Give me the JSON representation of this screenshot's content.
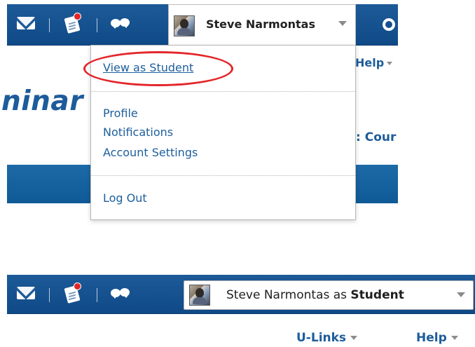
{
  "top": {
    "user_menu": {
      "user_name": "Steve Narmontas",
      "items": {
        "view_as_student": "View as Student",
        "profile": "Profile",
        "notifications": "Notifications",
        "account_settings": "Account Settings",
        "log_out": "Log Out"
      }
    },
    "page_fragments": {
      "course_title_fragment": "ninar",
      "help_fragment": "Help",
      "courses_fragment": ": Cour"
    }
  },
  "bottom": {
    "user_menu": {
      "name_part": "Steve Narmontas as ",
      "role_part": "Student"
    },
    "links": {
      "u_links": "U-Links",
      "help": "Help"
    }
  },
  "icons": {
    "mail": "mail-icon",
    "notes": "notes-icon",
    "chat": "chat-icon",
    "gear": "gear-icon",
    "dropdown": "chevron-down-icon"
  },
  "colors": {
    "nav_blue": "#1d5a98",
    "link_blue": "#1d5f9d",
    "highlight_red": "#e3262a"
  }
}
